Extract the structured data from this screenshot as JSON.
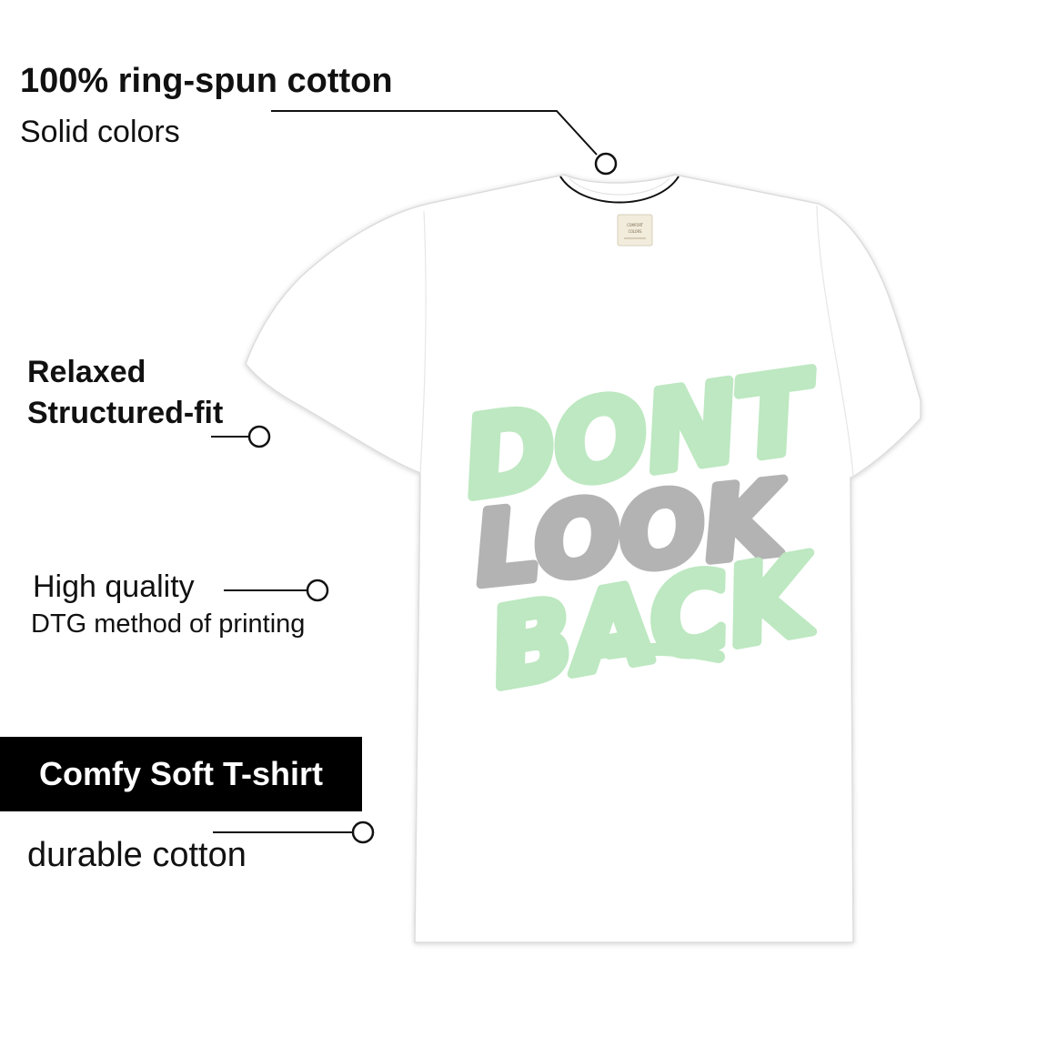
{
  "features": {
    "fabric_title": "100% ring-spun cotton",
    "fabric_subtitle": "Solid colors",
    "fit_title": "Relaxed",
    "fit_subtitle": "Structured-fit",
    "print_title": "High quality",
    "print_subtitle": "DTG method of printing",
    "badge_label": "Comfy Soft T-shirt",
    "durability_label": "durable cotton"
  },
  "shirt": {
    "color": "#ffffff",
    "label_line1": "COMFORT",
    "label_line2": "COLORS",
    "print": {
      "line1": "DONT",
      "line2": "LOOK",
      "line3": "BACK",
      "color_primary": "#bde8c1",
      "color_secondary": "#b3b3b3"
    }
  },
  "colors": {
    "text": "#111111",
    "badge_background": "#000000",
    "badge_text": "#ffffff"
  }
}
